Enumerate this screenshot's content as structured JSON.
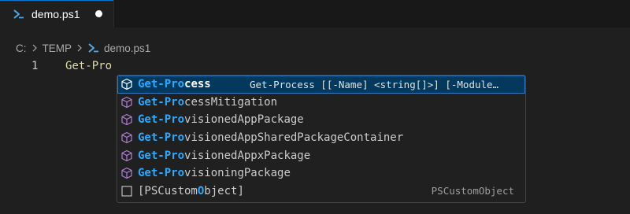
{
  "tab": {
    "label": "demo.ps1",
    "icon": "powershell-icon",
    "dirty": true
  },
  "breadcrumb": {
    "drive": "C:",
    "folder": "TEMP",
    "file": "demo.ps1"
  },
  "editor": {
    "line_number": "1",
    "code": "Get-Pro"
  },
  "suggestions": [
    {
      "match": "Get-Pro",
      "rest": "cess",
      "detail": "Get-Process [[-Name] <string[]>] [-Module…",
      "icon": "cube-icon",
      "selected": true
    },
    {
      "match": "Get-Pro",
      "rest": "cessMitigation",
      "icon": "cube-icon"
    },
    {
      "match": "Get-Pro",
      "rest": "visionedAppPackage",
      "icon": "cube-icon"
    },
    {
      "match": "Get-Pro",
      "rest": "visionedAppSharedPackageContainer",
      "icon": "cube-icon"
    },
    {
      "match": "Get-Pro",
      "rest": "visionedAppxPackage",
      "icon": "cube-icon"
    },
    {
      "match": "Get-Pro",
      "rest": "visioningPackage",
      "icon": "cube-icon"
    },
    {
      "pre": "[PSCustom",
      "match": "O",
      "post": "bject]",
      "detail_right": "PSCustomObject",
      "icon": "class-icon"
    }
  ],
  "colors": {
    "accent": "#0078d4",
    "match_highlight": "#2aaaff",
    "cube": "#b180d7",
    "selected_bg": "#04395e",
    "code": "#dcdcaa"
  }
}
